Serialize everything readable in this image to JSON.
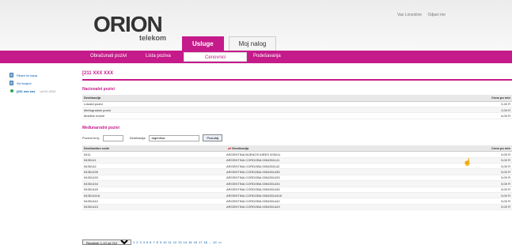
{
  "header": {
    "logo_main": "ORION",
    "logo_sub": "telekom",
    "top_links": [
      "Vas Lonzoline",
      "Odjavi me"
    ]
  },
  "main_tabs": [
    {
      "label": "Usluge",
      "active": true
    },
    {
      "label": "Moj nalog",
      "active": false
    }
  ],
  "subnav": [
    {
      "label": "Obračunati pozivi"
    },
    {
      "label": "Lista poziva"
    },
    {
      "label": "Cenovnici",
      "active": true
    },
    {
      "label": "Podešavanja"
    }
  ],
  "sidebar": {
    "items": [
      {
        "label": "Fiksni for kaua",
        "icon": "document-icon"
      },
      {
        "label": "Svi brojevi",
        "icon": "document-icon"
      },
      {
        "label": "[211 xxx xxx",
        "sub": "od 01.2010",
        "icon": "status-dot-icon"
      }
    ]
  },
  "content": {
    "page_title": "[211 XXX XXX",
    "national": {
      "title": "Nacionalni pozivi",
      "headers": [
        "Destinacija",
        "Cena po min"
      ],
      "rows": [
        [
          "Lokalni pozivi",
          "0,40 R"
        ],
        [
          "Međugradski pozivi",
          "2,00 R"
        ],
        [
          "Mobilne mreže",
          "6,00 R"
        ]
      ]
    },
    "international": {
      "title": "Međunarodni pozivi",
      "filter": {
        "number_label": "Pozivni broj:",
        "number_value": "",
        "destination_label": "Destinacija:",
        "destination_value": "argentina",
        "button_label": "Pozudaj"
      },
      "headers": [
        "Destination code",
        "Destinacija",
        "Cena po min"
      ],
      "rows": [
        [
          "5411",
          "ARGENTINA BUENOS AIRES 005411",
          "5,00 R"
        ],
        [
          "5435141",
          "ARGENTINA CORDOBA 0054351141",
          "5,00 R"
        ],
        [
          "5435142",
          "ARGENTINA CORDOBA 0054351142",
          "5,00 R"
        ],
        [
          "54351435",
          "ARGENTINA CORDOBA 0054351435",
          "5,00 R"
        ],
        [
          "54351433",
          "ARGENTINA CORDOBA 0054351433",
          "5,00 R"
        ],
        [
          "54351434",
          "ARGENTINA CORDOBA 0054351434",
          "5,00 R"
        ],
        [
          "54351445",
          "ARGENTINA CORDOBA 0054351445",
          "5,00 R"
        ],
        [
          "543514418",
          "ARGENTINA CORDOBA 00543514418",
          "5,00 R"
        ],
        [
          "54351442",
          "ARGENTINA CORDOBA 0054351442",
          "5,00 R"
        ],
        [
          "54351443",
          "ARGENTINA CORDOBA 0054351443",
          "5,00 R"
        ]
      ]
    }
  },
  "pager": {
    "summary": "Rezultati: 1-10 od 212",
    "pages": [
      "1",
      "2",
      "3",
      "4",
      "5",
      "6",
      "7",
      "8",
      "9",
      "10",
      "11",
      "12",
      "13",
      "14",
      "15",
      "16",
      "17",
      "18",
      "...",
      "22",
      ">>"
    ]
  },
  "colors": {
    "brand": "#c51a8a"
  }
}
